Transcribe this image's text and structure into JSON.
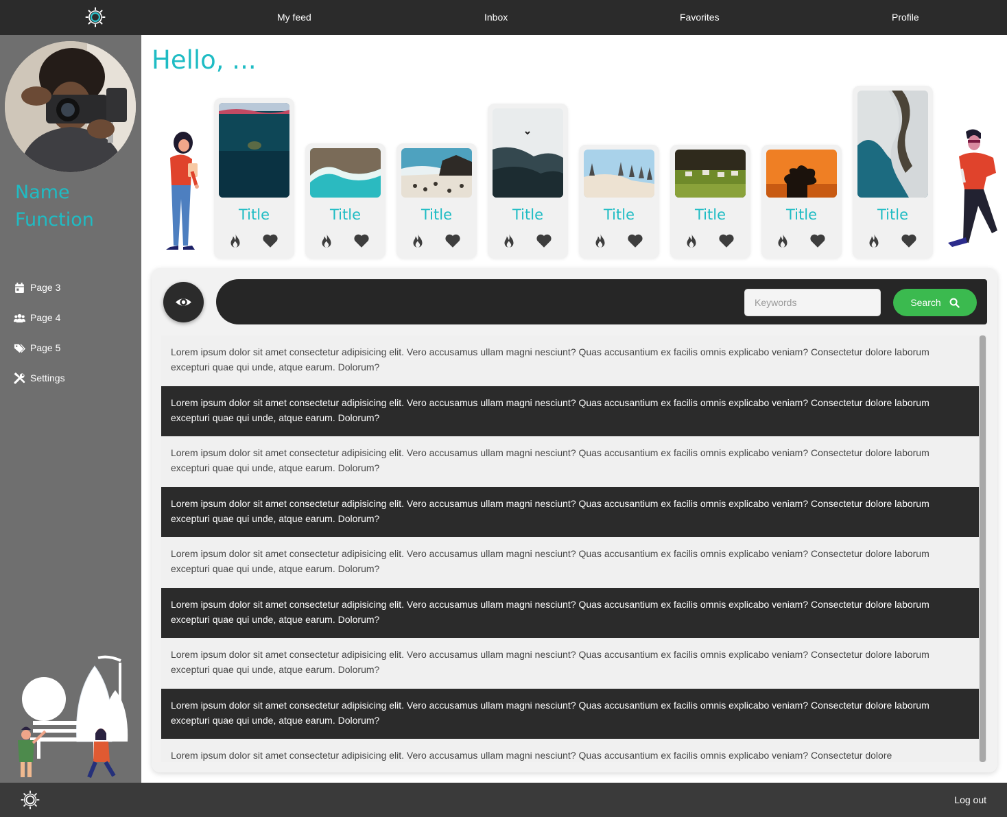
{
  "nav": {
    "logo_icon": "sun-gear-icon",
    "items": [
      {
        "label": "My feed"
      },
      {
        "label": "Inbox"
      },
      {
        "label": "Favorites"
      },
      {
        "label": "Profile"
      }
    ]
  },
  "sidebar": {
    "name": "Name",
    "function": "Function",
    "items": [
      {
        "label": "Page 3",
        "icon": "calendar-icon"
      },
      {
        "label": "Page 4",
        "icon": "users-icon"
      },
      {
        "label": "Page 5",
        "icon": "tags-icon"
      },
      {
        "label": "Settings",
        "icon": "tools-icon"
      }
    ]
  },
  "greeting": "Hello, ...",
  "cards": [
    {
      "title": "Title",
      "image": "underwater-turtle"
    },
    {
      "title": "Title",
      "image": "aerial-beach"
    },
    {
      "title": "Title",
      "image": "penguins-rocks"
    },
    {
      "title": "Title",
      "image": "misty-mountains"
    },
    {
      "title": "Title",
      "image": "pelicans"
    },
    {
      "title": "Title",
      "image": "zebras-savanna"
    },
    {
      "title": "Title",
      "image": "orange-sunset-tree"
    },
    {
      "title": "Title",
      "image": "snowy-river"
    }
  ],
  "search": {
    "placeholder": "Keywords",
    "button_label": "Search"
  },
  "feed": {
    "rows": [
      {
        "text": "Lorem ipsum dolor sit amet consectetur adipisicing elit. Vero accusamus ullam magni nesciunt? Quas accusantium ex facilis omnis explicabo veniam? Consectetur dolore laborum excepturi quae qui unde, atque earum. Dolorum?"
      },
      {
        "text": "Lorem ipsum dolor sit amet consectetur adipisicing elit. Vero accusamus ullam magni nesciunt? Quas accusantium ex facilis omnis explicabo veniam? Consectetur dolore laborum excepturi quae qui unde, atque earum. Dolorum?"
      },
      {
        "text": "Lorem ipsum dolor sit amet consectetur adipisicing elit. Vero accusamus ullam magni nesciunt? Quas accusantium ex facilis omnis explicabo veniam? Consectetur dolore laborum excepturi quae qui unde, atque earum. Dolorum?"
      },
      {
        "text": "Lorem ipsum dolor sit amet consectetur adipisicing elit. Vero accusamus ullam magni nesciunt? Quas accusantium ex facilis omnis explicabo veniam? Consectetur dolore laborum excepturi quae qui unde, atque earum. Dolorum?"
      },
      {
        "text": "Lorem ipsum dolor sit amet consectetur adipisicing elit. Vero accusamus ullam magni nesciunt? Quas accusantium ex facilis omnis explicabo veniam? Consectetur dolore laborum excepturi quae qui unde, atque earum. Dolorum?"
      },
      {
        "text": "Lorem ipsum dolor sit amet consectetur adipisicing elit. Vero accusamus ullam magni nesciunt? Quas accusantium ex facilis omnis explicabo veniam? Consectetur dolore laborum excepturi quae qui unde, atque earum. Dolorum?"
      },
      {
        "text": "Lorem ipsum dolor sit amet consectetur adipisicing elit. Vero accusamus ullam magni nesciunt? Quas accusantium ex facilis omnis explicabo veniam? Consectetur dolore laborum excepturi quae qui unde, atque earum. Dolorum?"
      },
      {
        "text": "Lorem ipsum dolor sit amet consectetur adipisicing elit. Vero accusamus ullam magni nesciunt? Quas accusantium ex facilis omnis explicabo veniam? Consectetur dolore laborum excepturi quae qui unde, atque earum. Dolorum?"
      },
      {
        "text": "Lorem ipsum dolor sit amet consectetur adipisicing elit. Vero accusamus ullam magni nesciunt? Quas accusantium ex facilis omnis explicabo veniam? Consectetur dolore"
      }
    ]
  },
  "footer": {
    "logo_icon": "sun-gear-icon",
    "logout_label": "Log out"
  },
  "colors": {
    "accent": "#1fbcc4",
    "search_button": "#3bba4f",
    "dark": "#2b2b2b",
    "sidebar": "#6f6f6f"
  }
}
